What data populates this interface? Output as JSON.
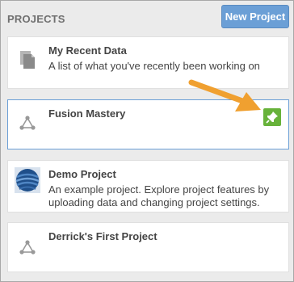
{
  "header": {
    "title": "PROJECTS",
    "new_project_label": "New Project"
  },
  "projects": [
    {
      "title": "My Recent Data",
      "description": "A list of what you've recently been working on",
      "icon": "documents-icon"
    },
    {
      "title": "Fusion Mastery",
      "description": "",
      "icon": "project-nodes-icon",
      "selected": true,
      "pin_icon": "pin-icon"
    },
    {
      "title": "Demo Project",
      "description": "An example project. Explore project features by uploading data and changing project settings.",
      "icon": "globe-thumbnail-icon"
    },
    {
      "title": "Derrick's First Project",
      "description": "",
      "icon": "project-nodes-icon"
    }
  ],
  "colors": {
    "accent": "#6b9fd6",
    "pin_green": "#67b23a",
    "annotation_arrow": "#f0a030"
  }
}
